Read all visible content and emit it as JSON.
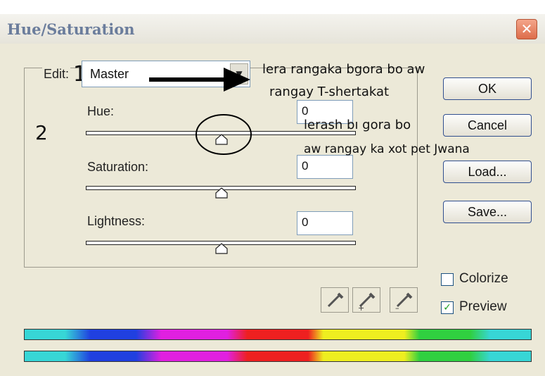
{
  "dialog": {
    "title": "Hue/Saturation",
    "close_glyph": "✕"
  },
  "edit": {
    "label": "Edit:",
    "value": "Master",
    "dropdown_glyph": "▼"
  },
  "markers": {
    "one": "1",
    "two": "2"
  },
  "sliders": {
    "hue": {
      "label": "Hue:",
      "value": "0",
      "position": 0.5
    },
    "saturation": {
      "label": "Saturation:",
      "value": "0",
      "position": 0.5
    },
    "lightness": {
      "label": "Lightness:",
      "value": "0",
      "position": 0.5
    }
  },
  "buttons": {
    "ok": "OK",
    "cancel": "Cancel",
    "load": "Load...",
    "save": "Save..."
  },
  "options": {
    "colorize": {
      "label": "Colorize",
      "checked": false
    },
    "preview": {
      "label": "Preview",
      "checked": true,
      "check_glyph": "✓"
    }
  },
  "annotations": {
    "line1": "lera rangaka bgora bo aw",
    "line2": "rangay T-shertakat",
    "line3": "lerash bı gora bo",
    "line4": "aw rangay ka xot pet Jwana"
  },
  "icons": [
    "eyedropper-icon",
    "eyedropper-plus-icon",
    "eyedropper-minus-icon"
  ]
}
